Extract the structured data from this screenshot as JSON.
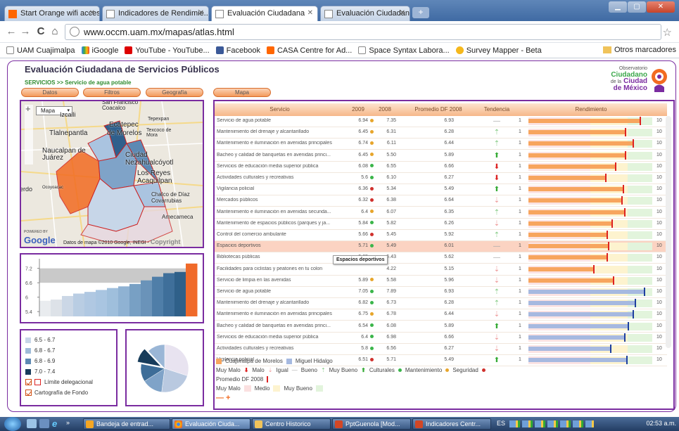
{
  "browser": {
    "tabs": [
      {
        "label": "Start Orange wifi access",
        "active": false
      },
      {
        "label": "Indicadores de Rendimie...",
        "active": false
      },
      {
        "label": "Evaluación Ciudadana",
        "active": true
      },
      {
        "label": "Evaluación Ciudadana",
        "active": false
      }
    ],
    "url": "www.occm.uam.mx/mapas/atlas.html",
    "bookmarks": [
      "UAM Cuajimalpa",
      "iGoogle",
      "YouTube - YouTube...",
      "Facebook",
      "CASA Centre for Ad...",
      "Space Syntax Labora...",
      "Survey Mapper - Beta"
    ],
    "other_bookmarks": "Otros marcadores"
  },
  "page": {
    "title": "Evaluación Ciudadana de Servicios Públicos",
    "breadcrumb_section": "SERVICIOS >>",
    "breadcrumb_item": "Servicio de agua potable",
    "logo": {
      "line1": "Observatorio",
      "line2": "Ciudadano",
      "line3": "de la",
      "line4": "Ciudad",
      "line5": "de México"
    },
    "buttons": [
      "Datos",
      "Filtros",
      "Geografía",
      "Mapa"
    ]
  },
  "map": {
    "type_selector": "Mapa",
    "labels": [
      "Izcalli",
      "Tlalnepantla",
      "Ecatepec",
      "de Morelos",
      "Tepexpan",
      "Texcoco de Mora",
      "Naucalpan de Juárez",
      "Ciudad Nezahualcóyotl",
      "Los Reyes Acaquilpan",
      "Chalco de Díaz Covarrubias",
      "Amecameca",
      "San Francisco Coacalco",
      "erdo",
      "Ocoyoacac"
    ],
    "attribution": "Datos de mapa ©2010 Google, INEGI - ",
    "copyright": "Copyright",
    "powered_by": "POWERED BY",
    "google": "Google"
  },
  "bar_chart": {
    "yticks": [
      "7.2",
      "6.6",
      "6",
      "5.4"
    ],
    "values": [
      5.85,
      5.9,
      6.05,
      6.15,
      6.22,
      6.3,
      6.38,
      6.45,
      6.55,
      6.7,
      6.85,
      7.0,
      7.05,
      7.4
    ],
    "bar_colors": [
      "#e9ecef",
      "#dde2e8",
      "#cbd7e6",
      "#b9cde3",
      "#b0c8e2",
      "#a9c5e1",
      "#9fbfdc",
      "#8fb2d3",
      "#78a0c4",
      "#6a93b9",
      "#4f7ea8",
      "#3f6f9a",
      "#2f6089",
      "#f06a2a"
    ],
    "ymin": 5.2,
    "ymax": 7.6,
    "ref_bands": [
      6.6,
      7.2
    ]
  },
  "legend": {
    "items": [
      {
        "label": "6.5 - 6.7",
        "color": "#c7d6e8"
      },
      {
        "label": "6.8 - 6.7",
        "color": "#9fbcd9"
      },
      {
        "label": "6.8 - 6.9",
        "color": "#5d89b3"
      },
      {
        "label": "7.0 - 7.4",
        "color": "#173c5b"
      }
    ],
    "checks": [
      {
        "label": "Límite delegacional",
        "checked": true
      },
      {
        "label": "Cartografía de Fondo",
        "checked": true
      }
    ]
  },
  "pie": {
    "values": [
      30,
      22,
      14,
      12,
      10,
      12
    ],
    "colors": [
      "#e8e3f0",
      "#b9c9e0",
      "#7fa3c8",
      "#3d6d98",
      "#173c5b",
      "#9ab6d6"
    ]
  },
  "table": {
    "headers": [
      "Servicio",
      "2009",
      "2008",
      "Promedio DF 2008",
      "Tendencia",
      "Rendimiento"
    ],
    "rows": [
      {
        "name": "Servicio de agua potable",
        "v2009": "6.94",
        "c2009": "#e7a52b",
        "v2008": "7.35",
        "prom": "6.93",
        "trend": "same",
        "perf": 0.9,
        "group": "orange"
      },
      {
        "name": "Mantenimiento del drenaje y alcantarillado",
        "v2009": "6.45",
        "c2009": "#e7a52b",
        "v2008": "6.31",
        "prom": "6.28",
        "trend": "up-s",
        "perf": 0.78,
        "group": "orange"
      },
      {
        "name": "Mantenimiento e iluminación en avenidas principales",
        "v2009": "6.74",
        "c2009": "#e7a52b",
        "v2008": "6.11",
        "prom": "6.44",
        "trend": "up-s",
        "perf": 0.84,
        "group": "orange"
      },
      {
        "name": "Bacheo y calidad de banquetas en avenidas princi...",
        "v2009": "6.45",
        "c2009": "#e7a52b",
        "v2008": "5.50",
        "prom": "5.89",
        "trend": "up",
        "perf": 0.78,
        "group": "orange"
      },
      {
        "name": "Servicios de educación media superior pública",
        "v2009": "6.08",
        "c2009": "#3bb54a",
        "v2008": "6.55",
        "prom": "6.66",
        "trend": "down",
        "perf": 0.7,
        "group": "orange"
      },
      {
        "name": "Actividades culturales y recreativas",
        "v2009": "5.6",
        "c2009": "#3bb54a",
        "v2008": "6.10",
        "prom": "6.27",
        "trend": "down",
        "perf": 0.62,
        "group": "orange"
      },
      {
        "name": "Vigilancia policial",
        "v2009": "6.36",
        "c2009": "#d0312d",
        "v2008": "5.34",
        "prom": "5.49",
        "trend": "up",
        "perf": 0.76,
        "group": "orange"
      },
      {
        "name": "Mercados públicos",
        "v2009": "6.32",
        "c2009": "#d0312d",
        "v2008": "6.38",
        "prom": "6.64",
        "trend": "down-s",
        "perf": 0.75,
        "group": "orange"
      },
      {
        "name": "Mantenimiento e iluminación en avenidas secunda...",
        "v2009": "6.4",
        "c2009": "#e7a52b",
        "v2008": "6.07",
        "prom": "6.35",
        "trend": "up-s",
        "perf": 0.77,
        "group": "orange"
      },
      {
        "name": "Mantenimiento de espacios públicos (parques y ja...",
        "v2009": "5.84",
        "c2009": "#3bb54a",
        "v2008": "5.82",
        "prom": "6.26",
        "trend": "down-s",
        "perf": 0.67,
        "group": "orange"
      },
      {
        "name": "Control del comercio ambulante",
        "v2009": "5.66",
        "c2009": "#d0312d",
        "v2008": "5.45",
        "prom": "5.92",
        "trend": "up-s",
        "perf": 0.63,
        "group": "orange"
      },
      {
        "name": "Espacios deportivos",
        "v2009": "5.71",
        "c2009": "#3bb54a",
        "v2008": "5.49",
        "prom": "6.01",
        "trend": "same",
        "perf": 0.64,
        "group": "orange",
        "highlight": true
      },
      {
        "name": "Bibliotecas públicas",
        "v2009": "5.65",
        "c2009": "#3bb54a",
        "v2008": "5.43",
        "prom": "5.62",
        "trend": "same",
        "perf": 0.63,
        "group": "orange"
      },
      {
        "name": "Facilidades para ciclistas y peatones en tu colon",
        "v2009": "",
        "c2009": "",
        "v2008": "4.22",
        "prom": "5.15",
        "trend": "down-s",
        "perf": 0.52,
        "group": "orange"
      },
      {
        "name": "Servicio de limpia en las avenidas",
        "v2009": "5.89",
        "c2009": "#e7a52b",
        "v2008": "5.58",
        "prom": "5.96",
        "trend": "down-s",
        "perf": 0.68,
        "group": "orange"
      },
      {
        "name": "Servicio de agua potable",
        "v2009": "7.05",
        "c2009": "#3bb54a",
        "v2008": "7.89",
        "prom": "6.93",
        "trend": "up-s",
        "perf": 0.93,
        "group": "blue"
      },
      {
        "name": "Mantenimiento del drenaje y alcantarillado",
        "v2009": "6.82",
        "c2009": "#3bb54a",
        "v2008": "6.73",
        "prom": "6.28",
        "trend": "up-s",
        "perf": 0.86,
        "group": "blue"
      },
      {
        "name": "Mantenimiento e iluminación en avenidas principales",
        "v2009": "6.75",
        "c2009": "#e7a52b",
        "v2008": "6.78",
        "prom": "6.44",
        "trend": "down-s",
        "perf": 0.84,
        "group": "blue"
      },
      {
        "name": "Bacheo y calidad de banquetas en avenidas princi...",
        "v2009": "6.54",
        "c2009": "#3bb54a",
        "v2008": "6.08",
        "prom": "5.89",
        "trend": "up",
        "perf": 0.8,
        "group": "blue"
      },
      {
        "name": "Servicios de educación media superior pública",
        "v2009": "6.4",
        "c2009": "#3bb54a",
        "v2008": "6.98",
        "prom": "6.66",
        "trend": "down-s",
        "perf": 0.77,
        "group": "blue"
      },
      {
        "name": "Actividades culturales y recreativas",
        "v2009": "5.8",
        "c2009": "#3bb54a",
        "v2008": "6.56",
        "prom": "6.27",
        "trend": "down-s",
        "perf": 0.66,
        "group": "blue"
      },
      {
        "name": "Vigilancia policial",
        "v2009": "6.51",
        "c2009": "#d0312d",
        "v2008": "5.71",
        "prom": "5.49",
        "trend": "up",
        "perf": 0.79,
        "group": "blue"
      }
    ],
    "scale_min": "1",
    "scale_max": "10",
    "tooltip": "Espacios deportivos",
    "legend": {
      "series1": "Cuajimalpa de Morelos",
      "series2": "Miguel Hidalgo",
      "trend_labels": [
        "Muy Malo",
        "Malo",
        "Igual",
        "Bueno",
        "Muy Bueno"
      ],
      "categories": [
        "Culturales",
        "Mantenimiento",
        "Seguridad"
      ],
      "category_colors": [
        "#3bb54a",
        "#e7a52b",
        "#d0312d"
      ],
      "promedio": "Promedio DF 2008",
      "scale_labels": [
        "Muy Malo",
        "Medio",
        "Muy Bueno"
      ],
      "scale_colors": [
        "#fbe0e0",
        "#fdf3cf",
        "#e2f4dc"
      ],
      "zoom": "— +"
    }
  },
  "taskbar": {
    "items": [
      "Bandeja de entrad...",
      "Evaluación Ciuda...",
      "Centro Historico",
      "PptGuenola [Mod...",
      "Indicadores Centr..."
    ],
    "lang": "ES",
    "clock": "02:53 a.m."
  }
}
